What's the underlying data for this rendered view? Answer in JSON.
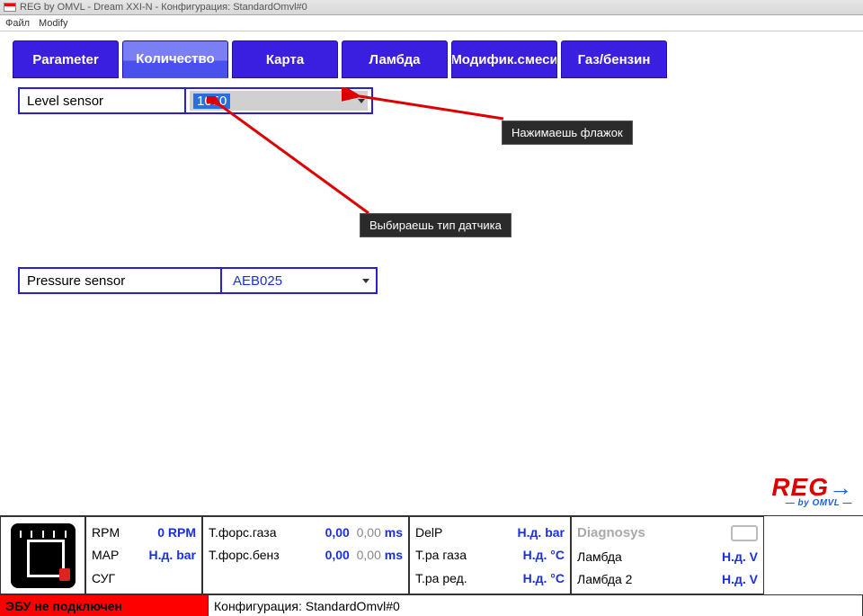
{
  "title": "REG by OMVL - Dream XXI-N - Конфигурация: StandardOmvl#0",
  "menu": {
    "file": "Файл",
    "modify": "Modify"
  },
  "tabs": {
    "parameter": "Parameter",
    "quantity": "Количество",
    "map": "Карта",
    "lambda": "Ламбда",
    "modmix": "Модифик.смеси",
    "gasfuel": "Газ/бензин"
  },
  "fields": {
    "level_label": "Level sensor",
    "level_value": "1050",
    "pressure_label": "Pressure sensor",
    "pressure_value": "AEB025"
  },
  "annotations": {
    "flag": "Нажимаешь флажок",
    "type": "Выбираешь тип датчика"
  },
  "logo": {
    "main": "REG",
    "sub": "— by OMVL —"
  },
  "status": {
    "rpm_label": "RPM",
    "rpm_value": "0",
    "rpm_unit": "RPM",
    "map_label": "MAP",
    "map_value": "Н.д.",
    "map_unit": "bar",
    "sug_label": "СУГ",
    "tfg_label": "Т.форс.газа",
    "tfg_v1": "0,00",
    "tfg_v2": "0,00",
    "ms": "ms",
    "tfb_label": "Т.форс.бенз",
    "tfb_v1": "0,00",
    "tfb_v2": "0,00",
    "delp_label": "DelP",
    "delp_value": "Н.д.",
    "delp_unit": "bar",
    "tgas_label": "Т.ра газа",
    "tgas_value": "Н.д.",
    "tgas_unit": "°C",
    "tred_label": "Т.ра ред.",
    "tred_value": "Н.д.",
    "tred_unit": "°C",
    "diag_title": "Diagnosys",
    "lam_label": "Ламбда",
    "lam_value": "Н.д.",
    "lam_unit": "V",
    "lam2_label": "Ламбда 2",
    "lam2_value": "Н.д.",
    "lam2_unit": "V"
  },
  "bottom": {
    "disconnected": "ЭБУ не подключен",
    "config": "Конфигурация: StandardOmvl#0"
  }
}
